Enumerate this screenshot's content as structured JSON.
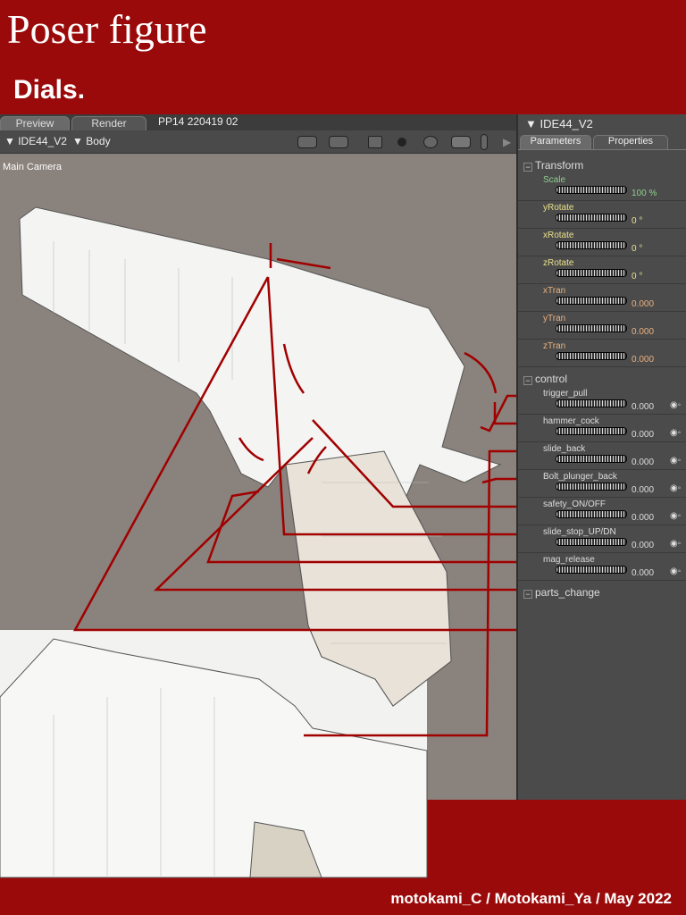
{
  "header": {
    "title": "Poser figure",
    "subtitle": "Dials."
  },
  "viewport": {
    "tabs": [
      "Preview",
      "Render"
    ],
    "title": "PP14  220419  02",
    "figure": "IDE44_V2",
    "actor": "Body",
    "camera": "Main Camera"
  },
  "panel": {
    "title": "IDE44_V2",
    "tabs": [
      "Parameters",
      "Properties"
    ],
    "groups": [
      {
        "name": "Transform",
        "params": [
          {
            "label": "Scale",
            "value": "100 %",
            "color": "#8fd08f"
          },
          {
            "label": "yRotate",
            "value": "0 °",
            "color": "#e8e08a"
          },
          {
            "label": "xRotate",
            "value": "0 °",
            "color": "#e8e08a"
          },
          {
            "label": "zRotate",
            "value": "0 °",
            "color": "#e8e08a"
          },
          {
            "label": "xTran",
            "value": "0.000",
            "color": "#e8b080"
          },
          {
            "label": "yTran",
            "value": "0.000",
            "color": "#e8b080"
          },
          {
            "label": "zTran",
            "value": "0.000",
            "color": "#e8b080"
          }
        ]
      },
      {
        "name": "control",
        "params": [
          {
            "label": "trigger_pull",
            "value": "0.000"
          },
          {
            "label": "hammer_cock",
            "value": "0.000"
          },
          {
            "label": "slide_back",
            "value": "0.000"
          },
          {
            "label": "Bolt_plunger_back",
            "value": "0.000"
          },
          {
            "label": "safety_ON/OFF",
            "value": "0.000"
          },
          {
            "label": "slide_stop_UP/DN",
            "value": "0.000"
          },
          {
            "label": "mag_release",
            "value": "0.000"
          }
        ]
      },
      {
        "name": "parts_change",
        "params": []
      }
    ]
  },
  "footer": {
    "credit": "motokami_C / Motokami_Ya / May 2022"
  },
  "colors": {
    "brand": "#9b0a0a",
    "annotation": "#a00000"
  }
}
